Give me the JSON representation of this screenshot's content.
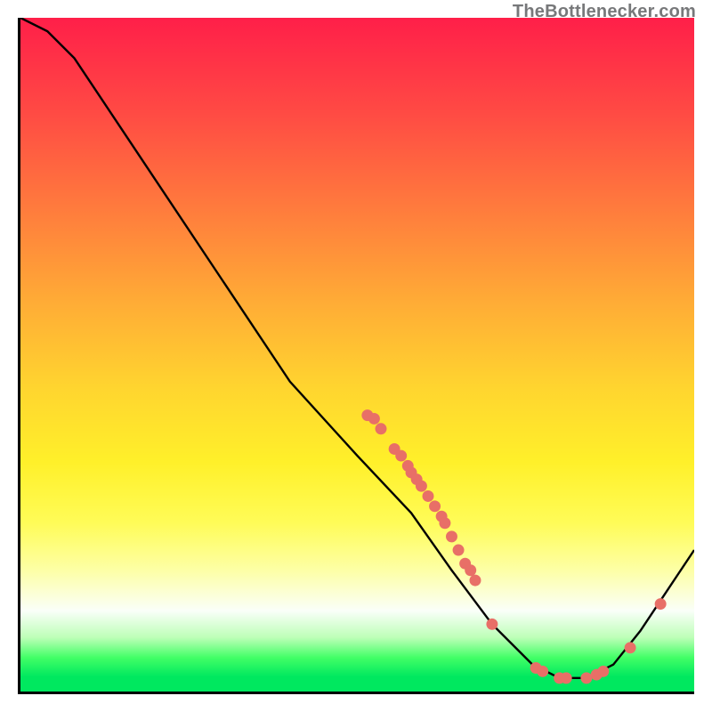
{
  "source_label": "TheBottlenecker.com",
  "colors": {
    "dot": "#e86f67",
    "curve": "#000000"
  },
  "chart_data": {
    "type": "line",
    "title": "",
    "xlabel": "",
    "ylabel": "",
    "xlim": [
      0,
      100
    ],
    "ylim": [
      0,
      100
    ],
    "curve": [
      {
        "x": 0.0,
        "y": 100.0
      },
      {
        "x": 4.0,
        "y": 98.0
      },
      {
        "x": 8.0,
        "y": 94.0
      },
      {
        "x": 12.0,
        "y": 88.0
      },
      {
        "x": 20.0,
        "y": 76.0
      },
      {
        "x": 30.0,
        "y": 61.0
      },
      {
        "x": 40.0,
        "y": 46.0
      },
      {
        "x": 50.0,
        "y": 35.0
      },
      {
        "x": 58.0,
        "y": 26.5
      },
      {
        "x": 64.0,
        "y": 18.0
      },
      {
        "x": 70.0,
        "y": 10.0
      },
      {
        "x": 76.0,
        "y": 4.0
      },
      {
        "x": 80.0,
        "y": 2.0
      },
      {
        "x": 84.0,
        "y": 2.0
      },
      {
        "x": 88.0,
        "y": 4.0
      },
      {
        "x": 92.0,
        "y": 9.0
      },
      {
        "x": 96.0,
        "y": 15.0
      },
      {
        "x": 100.0,
        "y": 21.0
      }
    ],
    "points": [
      {
        "x": 51.5,
        "y": 41.0
      },
      {
        "x": 52.5,
        "y": 40.5
      },
      {
        "x": 53.5,
        "y": 39.0
      },
      {
        "x": 55.5,
        "y": 36.0
      },
      {
        "x": 56.5,
        "y": 35.0
      },
      {
        "x": 57.5,
        "y": 33.5
      },
      {
        "x": 58.0,
        "y": 32.5
      },
      {
        "x": 58.8,
        "y": 31.5
      },
      {
        "x": 59.5,
        "y": 30.5
      },
      {
        "x": 60.5,
        "y": 29.0
      },
      {
        "x": 61.5,
        "y": 27.5
      },
      {
        "x": 62.5,
        "y": 26.0
      },
      {
        "x": 63.0,
        "y": 25.0
      },
      {
        "x": 64.0,
        "y": 23.0
      },
      {
        "x": 65.0,
        "y": 21.0
      },
      {
        "x": 66.0,
        "y": 19.0
      },
      {
        "x": 66.8,
        "y": 18.0
      },
      {
        "x": 67.5,
        "y": 16.5
      },
      {
        "x": 70.0,
        "y": 10.0
      },
      {
        "x": 76.5,
        "y": 3.5
      },
      {
        "x": 77.5,
        "y": 3.0
      },
      {
        "x": 80.0,
        "y": 2.0
      },
      {
        "x": 81.0,
        "y": 2.0
      },
      {
        "x": 84.0,
        "y": 2.0
      },
      {
        "x": 85.5,
        "y": 2.5
      },
      {
        "x": 86.5,
        "y": 3.0
      },
      {
        "x": 90.5,
        "y": 6.5
      },
      {
        "x": 95.0,
        "y": 13.0
      }
    ]
  }
}
